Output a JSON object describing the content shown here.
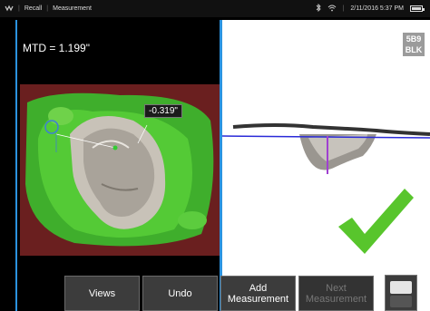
{
  "status_bar": {
    "app_icon": "gauge-logo-icon",
    "mode": "Recall",
    "section": "Measurement",
    "bluetooth_icon": "bluetooth-icon",
    "wifi_icon": "wifi-icon",
    "datetime": "2/11/2016  5:37 PM",
    "battery_icon": "battery-icon"
  },
  "left_view": {
    "measurement_label": "MTD = 1.199\"",
    "depth_callout": "-0.319\""
  },
  "right_view": {
    "badge_line1": "5B9",
    "badge_line2": "BLK",
    "result_icon": "checkmark-icon"
  },
  "toolbar": {
    "views_label": "Views",
    "undo_label": "Undo",
    "add_measurement_label_1": "Add",
    "add_measurement_label_2": "Measurement",
    "next_measurement_label_1": "Next",
    "next_measurement_label_2": "Measurement"
  },
  "colors": {
    "accent_blue": "#2b93e0",
    "check_green": "#58c52c",
    "overlay_green": "#4fd43a",
    "profile_purple": "#a040d0"
  }
}
